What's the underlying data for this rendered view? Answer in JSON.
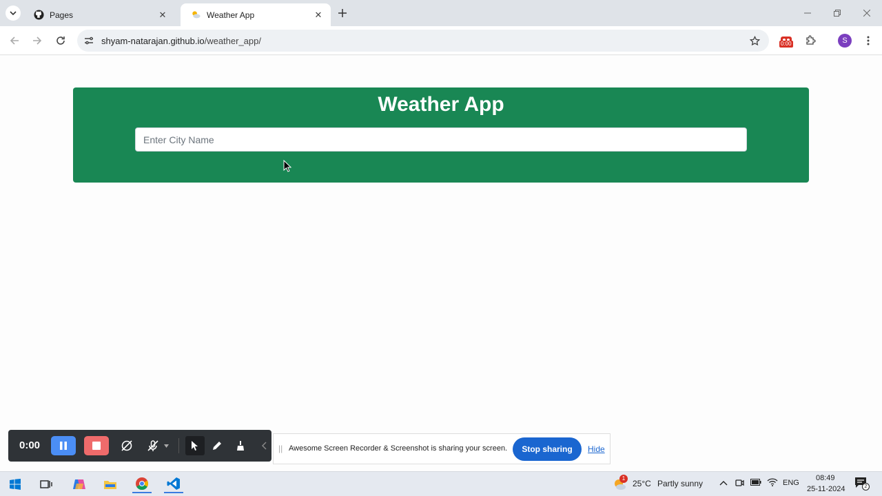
{
  "browser": {
    "tabs": [
      {
        "title": "Pages",
        "active": false,
        "icon": "github-icon"
      },
      {
        "title": "Weather App",
        "active": true,
        "icon": "weather-favicon"
      }
    ],
    "url": {
      "host": "shyam-natarajan.github.io",
      "path": "/weather_app/"
    },
    "profile_initial": "S",
    "recorder_ext_badge": "0:00"
  },
  "page": {
    "title": "Weather App",
    "search": {
      "placeholder": "Enter City Name",
      "value": ""
    },
    "colors": {
      "card": "#198754"
    }
  },
  "recorder": {
    "timer": "0:00"
  },
  "share_bar": {
    "message": "Awesome Screen Recorder & Screenshot is sharing your screen.",
    "stop_label": "Stop sharing",
    "hide_label": "Hide"
  },
  "taskbar": {
    "weather_temp": "25°C",
    "weather_desc": "Partly sunny",
    "weather_alert": "1",
    "language": "ENG",
    "time": "08:49",
    "date": "25-11-2024",
    "notifications": "2"
  }
}
